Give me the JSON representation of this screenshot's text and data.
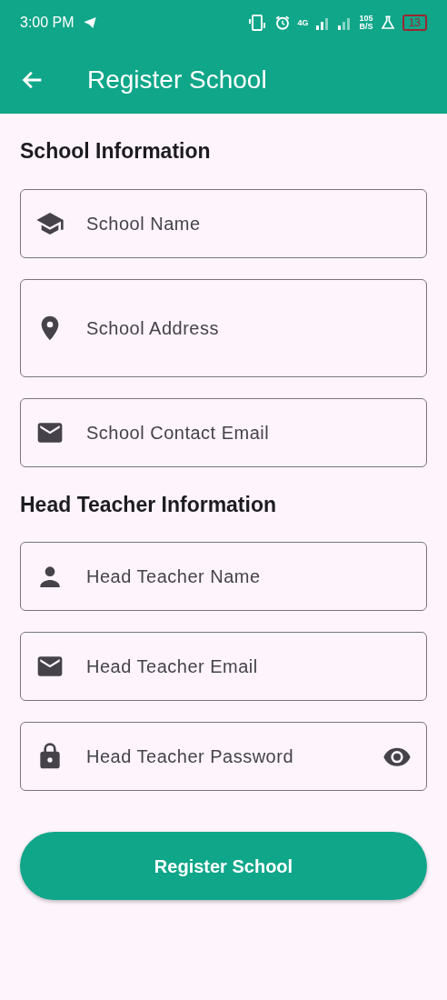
{
  "status_bar": {
    "time": "3:00 PM",
    "network": "4G",
    "speed": "105",
    "speed_unit": "B/S",
    "battery": "13"
  },
  "app_bar": {
    "title": "Register School"
  },
  "sections": [
    {
      "heading": "School Information",
      "fields": [
        {
          "kind": "text",
          "placeholder": "School Name",
          "multiline": false
        },
        {
          "kind": "text",
          "placeholder": "School Address",
          "multiline": true
        },
        {
          "kind": "text",
          "placeholder": "School Contact Email",
          "multiline": false
        }
      ]
    },
    {
      "heading": "Head Teacher Information",
      "fields": [
        {
          "kind": "text",
          "placeholder": "Head Teacher Name",
          "multiline": false
        },
        {
          "kind": "text",
          "placeholder": "Head Teacher Email",
          "multiline": false
        },
        {
          "kind": "password",
          "placeholder": "Head Teacher Password",
          "multiline": false
        }
      ]
    }
  ],
  "submit": {
    "label": "Register School"
  }
}
